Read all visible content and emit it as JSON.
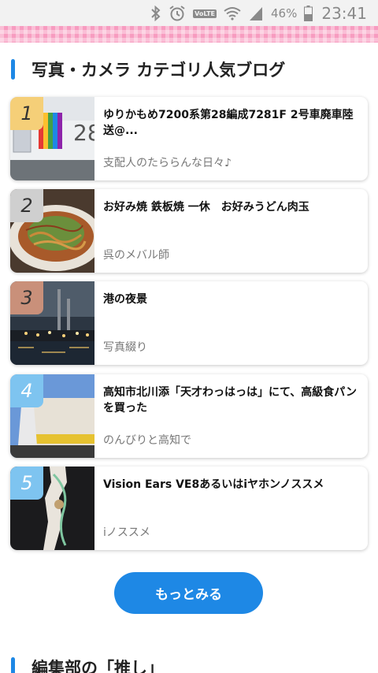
{
  "status_bar": {
    "icons": [
      "bluetooth-icon",
      "alarm-icon",
      "volte-icon",
      "wifi-icon",
      "signal-icon",
      "battery-icon"
    ],
    "volte_label": "VoLTE",
    "battery": "46%",
    "time": "23:41"
  },
  "section": {
    "title": "写真・カメラ カテゴリ人気ブログ"
  },
  "items": [
    {
      "rank": "1",
      "title": "ゆりかもめ7200系第28編成7281F 2号車廃車陸送@...",
      "blog": "支配人のたららんな日々♪",
      "rank_color": "#f5cf78"
    },
    {
      "rank": "2",
      "title": "お好み焼 鉄板焼 一休　お好みうどん肉玉",
      "blog": "呉のメバル師",
      "rank_color": "#cfcfcf"
    },
    {
      "rank": "3",
      "title": "港の夜景",
      "blog": "写真綴り",
      "rank_color": "#c9907a"
    },
    {
      "rank": "4",
      "title": "高知市北川添「天才わっはっは」にて、高級食パンを買った",
      "blog": "のんびりと高知で",
      "rank_color": "#7ec4f0"
    },
    {
      "rank": "5",
      "title": "Vision Ears VE8あるいはiヤホンノススメ",
      "blog": "iノススメ",
      "rank_color": "#7ec4f0"
    }
  ],
  "more_button": "もっとみる",
  "next_section": {
    "title": "編集部の「推し」"
  },
  "colors": {
    "accent": "#1e88e5",
    "band_pink": "#f79cc0"
  }
}
